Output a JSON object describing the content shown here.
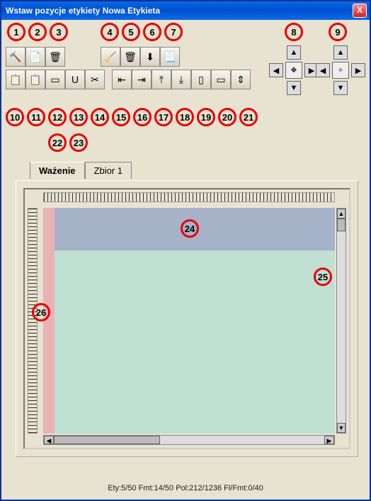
{
  "window": {
    "title": "Wstaw pozycje etykiety Nowa Etykieta",
    "close": "X"
  },
  "circles": {
    "r1": [
      "1",
      "2",
      "3",
      "4",
      "5",
      "6",
      "7",
      "8",
      "9"
    ],
    "r2": [
      "10",
      "11",
      "12",
      "13",
      "14",
      "15",
      "16",
      "17",
      "18",
      "19",
      "20",
      "21"
    ],
    "r3": [
      "22",
      "23"
    ],
    "canvas": {
      "c24": "24",
      "c25": "25",
      "c26": "26"
    }
  },
  "tabs": {
    "wazenie": "Ważenie",
    "zbior1": "Zbior 1"
  },
  "status": "Ety:5/50 Fmt:14/50 Pol:212/1236 Fl/Fmt:0/40",
  "icons": {
    "hammer": "🔨",
    "doc": "📄",
    "trash": "🗑",
    "broom": "🧹",
    "down": "⬇",
    "page": "📃",
    "copy": "📋",
    "paste": "📋",
    "select": "▭",
    "uline": "U",
    "scis": "✂",
    "al": "⇤",
    "ar": "⇥",
    "at": "⤒",
    "ab": "⤓",
    "ex1": "▯",
    "ex2": "▭",
    "ex3": "⇕",
    "up": "▲",
    "dn": "▼",
    "lt": "◀",
    "rt": "▶",
    "plus": "✥",
    "cross": "✧"
  }
}
